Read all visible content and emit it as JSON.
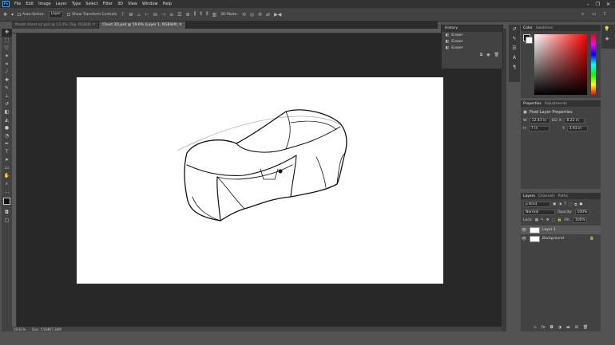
{
  "app": {
    "logo": "Ps"
  },
  "menu": [
    "File",
    "Edit",
    "Image",
    "Layer",
    "Type",
    "Select",
    "Filter",
    "3D",
    "View",
    "Window",
    "Help"
  ],
  "window_controls": {
    "minimize": "–",
    "restore": "❐",
    "close": "✕"
  },
  "options_bar": {
    "auto_select_label": "Auto-Select:",
    "auto_select_target": "Layer",
    "show_transform_label": "Show Transform Controls",
    "mode_label": "3D Mode:"
  },
  "doc_tabs": [
    {
      "label": "Model sheet x2.psd @ 13.3% (Top, RGB/8)"
    },
    {
      "label": "Chest 3D.psd @ 59.6% (Layer 1, RGB/8#)"
    }
  ],
  "status": {
    "zoom": "59.61%",
    "doc": "Doc: 5.93M/7.30M"
  },
  "history": {
    "title": "History",
    "items": [
      "Eraser",
      "Eraser",
      "Eraser"
    ]
  },
  "color_panel": {
    "tabs": [
      "Color",
      "Swatches"
    ],
    "fg_color": "#111111",
    "bg_color": "#ffffff",
    "hue_color": "#ff0000"
  },
  "properties": {
    "tabs": [
      "Properties",
      "Adjustments"
    ],
    "title": "Pixel Layer Properties",
    "w_label": "W:",
    "w_value": "12.43 in",
    "go_label": "GO",
    "x_label": "X:",
    "x_value": "8.22 in",
    "h_label": "H:",
    "h_value": "7 in",
    "y_label": "Y:",
    "y_value": "3.93 in"
  },
  "layers": {
    "tabs": [
      "Layers",
      "Channels",
      "Paths"
    ],
    "kind_label": "ρ Kind",
    "blend_mode": "Normal",
    "opacity_label": "Opacity:",
    "opacity_value": "100%",
    "lock_label": "Lock:",
    "fill_label": "Fill:",
    "fill_value": "100%",
    "items": [
      {
        "name": "Layer 1",
        "selected": true
      },
      {
        "name": "Background",
        "selected": false
      }
    ]
  }
}
